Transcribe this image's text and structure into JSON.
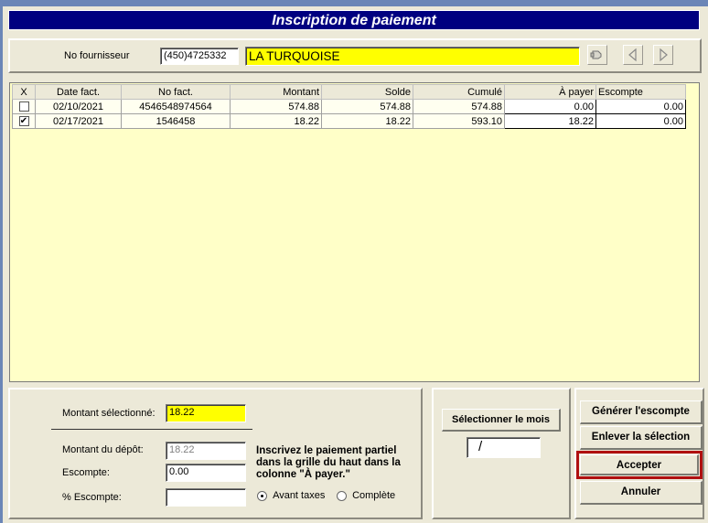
{
  "window": {
    "title": "Inscription de paiement"
  },
  "supplier": {
    "label": "No fournisseur",
    "phone": "(450)4725332",
    "name": "LA TURQUOISE"
  },
  "grid": {
    "headers": [
      "X",
      "Date fact.",
      "No fact.",
      "Montant",
      "Solde",
      "Cumulé",
      "À payer",
      "Escompte"
    ],
    "rows": [
      {
        "checked": false,
        "date": "02/10/2021",
        "invoice": "4546548974564",
        "amount": "574.88",
        "balance": "574.88",
        "cumulative": "574.88",
        "to_pay": "0.00",
        "discount": "0.00"
      },
      {
        "checked": true,
        "date": "02/17/2021",
        "invoice": "1546458",
        "amount": "18.22",
        "balance": "18.22",
        "cumulative": "593.10",
        "to_pay": "18.22",
        "discount": "0.00"
      }
    ]
  },
  "summary": {
    "selected_label": "Montant sélectionné:",
    "selected_value": "18.22",
    "deposit_label": "Montant du dépôt:",
    "deposit_value": "18.22",
    "discount_label": "Escompte:",
    "discount_value": "0.00",
    "pct_label": "% Escompte:",
    "pct_value": "",
    "hint": "Inscrivez le paiement partiel dans la grille du haut dans la colonne \"À payer.\"",
    "radio_before_tax": "Avant taxes",
    "radio_complete": "Complète",
    "radio_selected": "before_tax"
  },
  "month": {
    "button": "Sélectionner le mois",
    "value": "/"
  },
  "actions": {
    "generate": "Générer l'escompte",
    "remove": "Enlever la sélection",
    "accept": "Accepter",
    "cancel": "Annuler"
  },
  "colors": {
    "title_bg": "#000080",
    "highlight_yellow": "#ffff00",
    "grid_bg": "#ffffc8",
    "accept_outline": "#b01010"
  }
}
